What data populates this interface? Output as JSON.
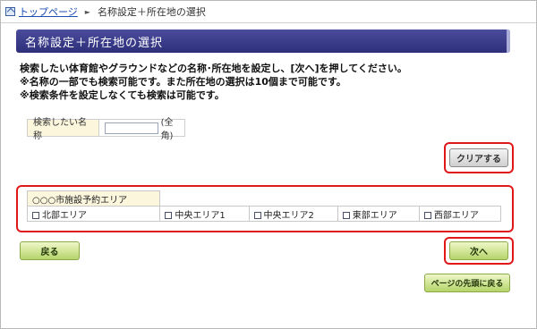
{
  "breadcrumb": {
    "home_label": "トップページ",
    "separator": "►",
    "current": "名称設定＋所在地の選択"
  },
  "title": "名称設定＋所在地の選択",
  "instructions": [
    "検索したい体育館やグラウンドなどの名称･所在地を設定し、[次へ]を押してください。",
    "※名称の一部でも検索可能です。また所在地の選択は10個まで可能です。",
    "※検索条件を設定しなくても検索は可能です。"
  ],
  "search": {
    "label": "検索したい名称",
    "value": "",
    "hint": "(全角)"
  },
  "clear_button": "クリアする",
  "area": {
    "header": "○○○市施設予約エリア",
    "options": [
      "北部エリア",
      "中央エリア1",
      "中央エリア2",
      "東部エリア",
      "西部エリア"
    ]
  },
  "back_button": "戻る",
  "next_button": "次へ",
  "top_button": "ページの先頭に戻る",
  "colors": {
    "title_bg": "#3c3e8c",
    "highlight": "#e01818",
    "button_green": "#b5d46a"
  }
}
